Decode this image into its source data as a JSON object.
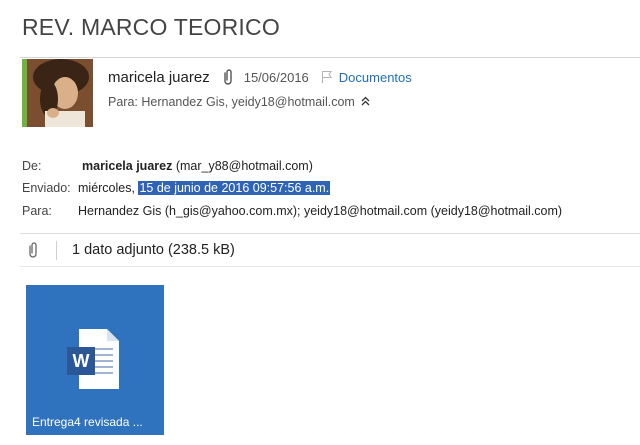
{
  "message": {
    "subject": "REV. MARCO TEORICO",
    "sender_name": "maricela juarez",
    "date": "15/06/2016",
    "folder": "Documentos",
    "to_summary": "Para: Hernandez Gis, yeidy18@hotmail.com"
  },
  "headers": {
    "from_label": "De:",
    "from_name": "maricela juarez",
    "from_email": "(mar_y88@hotmail.com)",
    "sent_label": "Enviado:",
    "sent_day": "miércoles,",
    "sent_date_selected": "15 de junio de 2016 09:57:56 a.m.",
    "to_label": "Para:",
    "to_value": "Hernandez Gis (h_gis@yahoo.com.mx); yeidy18@hotmail.com (yeidy18@hotmail.com)"
  },
  "attachments": {
    "summary": "1 dato adjunto (238.5 kB)",
    "items": [
      {
        "name": "Entrega4 revisada ...",
        "icon": "word-document-icon",
        "doc_letter": "W"
      }
    ]
  },
  "colors": {
    "presence_bar": "#6db33f",
    "link": "#1e6fb8",
    "selection": "#2f63b5",
    "tile": "#2f73bf"
  }
}
